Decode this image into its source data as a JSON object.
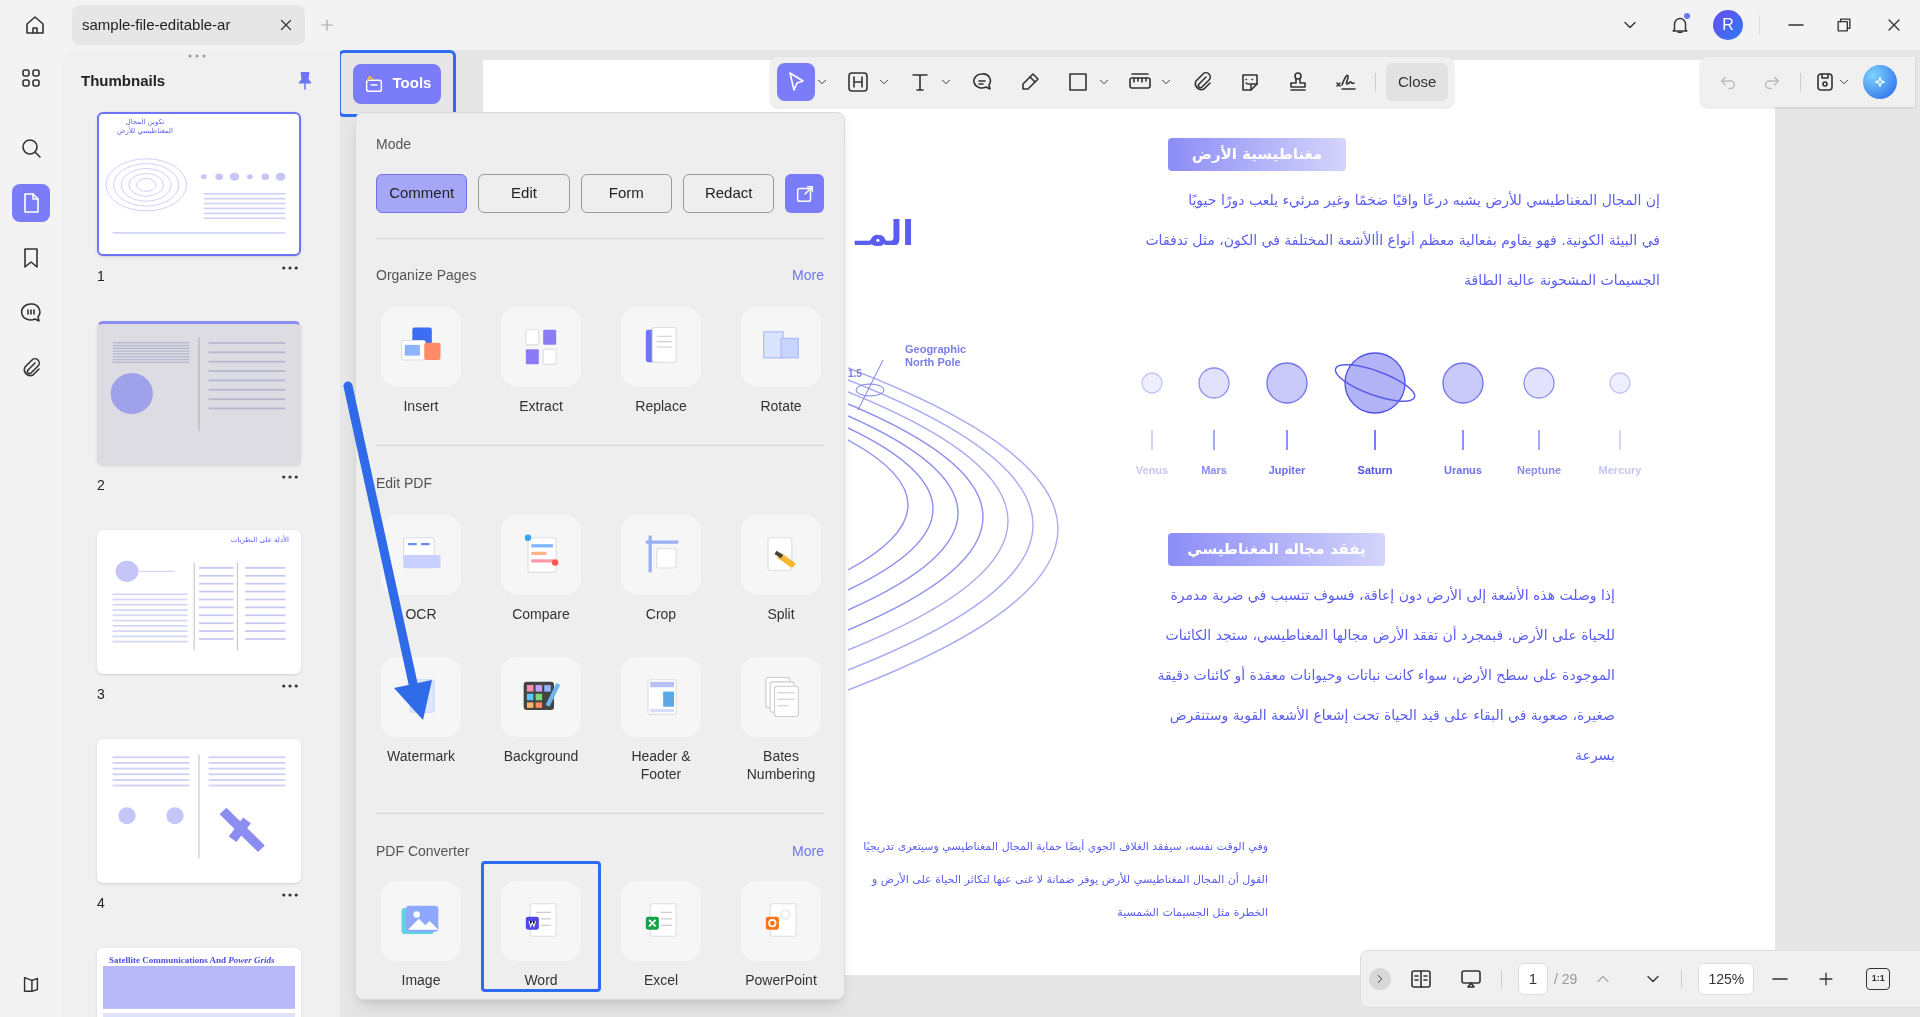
{
  "tab": {
    "title": "sample-file-editable-ar"
  },
  "notifications": {
    "unread": true
  },
  "account": {
    "initial": "R"
  },
  "rail": [
    {
      "selected": false
    },
    {
      "selected": false
    },
    {
      "selected": true
    },
    {
      "selected": false
    },
    {
      "selected": false
    },
    {
      "selected": false
    }
  ],
  "thumbnails": {
    "title": "Thumbnails",
    "pages": [
      {
        "number": "1",
        "selected": true,
        "hovered": false,
        "title": "تكوين المجال المغناطيسي للأرض"
      },
      {
        "number": "2",
        "selected": false,
        "hovered": true
      },
      {
        "number": "3",
        "selected": false,
        "hovered": false,
        "title": "الأدلة على النظريات"
      },
      {
        "number": "4",
        "selected": false,
        "hovered": false
      },
      {
        "selected": false,
        "hovered": false,
        "title": "Satellite Communications And *Power Grids*"
      }
    ]
  },
  "tools_button": {
    "label": "Tools",
    "highlighted": true
  },
  "toolbar": {
    "tools": [
      {
        "selected": true,
        "dropdown": true
      },
      {
        "selected": false,
        "dropdown": true
      },
      {
        "selected": false,
        "dropdown": true
      },
      {
        "selected": false,
        "dropdown": false
      },
      {
        "selected": false,
        "dropdown": false
      },
      {
        "selected": false,
        "dropdown": true
      },
      {
        "selected": false,
        "dropdown": true
      },
      {
        "selected": false,
        "dropdown": false
      },
      {
        "selected": false,
        "dropdown": false
      },
      {
        "selected": false,
        "dropdown": false
      },
      {
        "selected": false,
        "dropdown": false
      }
    ],
    "close": "Close"
  },
  "history": [
    {
      "disabled": true
    },
    {
      "disabled": true
    }
  ],
  "tools_menu": {
    "mode_title": "Mode",
    "modes": [
      {
        "label": "Comment",
        "selected": true
      },
      {
        "label": "Edit",
        "selected": false
      },
      {
        "label": "Form",
        "selected": false
      },
      {
        "label": "Redact",
        "selected": false
      }
    ],
    "sections": [
      {
        "title": "Organize Pages",
        "more": "More",
        "items": [
          {
            "label": "Insert",
            "highlighted": false
          },
          {
            "label": "Extract",
            "highlighted": false
          },
          {
            "label": "Replace",
            "highlighted": false
          },
          {
            "label": "Rotate",
            "highlighted": false
          }
        ]
      },
      {
        "title": "Edit PDF",
        "items": [
          {
            "label": "OCR",
            "highlighted": false
          },
          {
            "label": "Compare",
            "highlighted": false
          },
          {
            "label": "Crop",
            "highlighted": false
          },
          {
            "label": "Split",
            "highlighted": false
          },
          {
            "label": "Watermark",
            "highlighted": false
          },
          {
            "label": "Background",
            "highlighted": false
          },
          {
            "label": "Header & Footer",
            "highlighted": false
          },
          {
            "label": "Bates Numbering",
            "highlighted": false
          }
        ]
      },
      {
        "title": "PDF Converter",
        "more": "More",
        "items": [
          {
            "label": "Image",
            "highlighted": false
          },
          {
            "label": "Word",
            "highlighted": true
          },
          {
            "label": "Excel",
            "highlighted": false
          },
          {
            "label": "PowerPoint",
            "highlighted": false
          }
        ]
      }
    ]
  },
  "document": {
    "title_fragment": "المـ",
    "sections": [
      {
        "heading": "مغناطيسية الأرض",
        "lines": [
          "إن المجال المغناطيسي للأرض يشبه درعًا واقيًا ضخمًا وغير مرئيء يلعب دورًا حيويًا",
          "في البيئة الكونية. فهو يقاوم بفعالية معظم أنواع اأالأشعة المختلفة في الكون، مثل تدفقات",
          "الجسيمات المشحونة عالية الطاقة"
        ]
      },
      {
        "heading": "يفقد مجاله المغناطيسي",
        "lines": [
          "إذا وصلت هذه الأشعة إلى الأرض دون إعاقة، فسوف تتسبب في ضربة مدمرة",
          "للحياة على الأرض. فبمجرد أن تفقد الأرض مجالها المغناطيسي، ستجد الكائنات",
          "الموجودة على سطح الأرض، سواء كانت نباتات وحيوانات معقدة أو كائنات دقيقة",
          "صغيرة، صعوبة في البقاء على قيد الحياة تحت إشعاع الأشعة القوية وستنقرض",
          "بسرعة"
        ]
      }
    ],
    "pole_label": "Geographic North Pole",
    "angle_label": "1.5",
    "planets": [
      "Venus",
      "Mars",
      "Jupiter",
      "Saturn",
      "Uranus",
      "Neptune",
      "Mercury"
    ],
    "footnote_lines": [
      "وفي الوقت نفسه، سيفقد الغلاف الجوي أيضًا حماية المجال المغناطيسي وسيتعرى تدريجيًا",
      "القول أن المجال المغناطيسي للأرض يوفر ضمانة لا غنى عنها لتكاثر الحياة على الأرض و",
      "الخطرة مثل الجسيمات الشمسية"
    ]
  },
  "page_nav": {
    "page": "1",
    "total": "/ 29",
    "zoom": "125%",
    "actual_size": "1:1"
  }
}
